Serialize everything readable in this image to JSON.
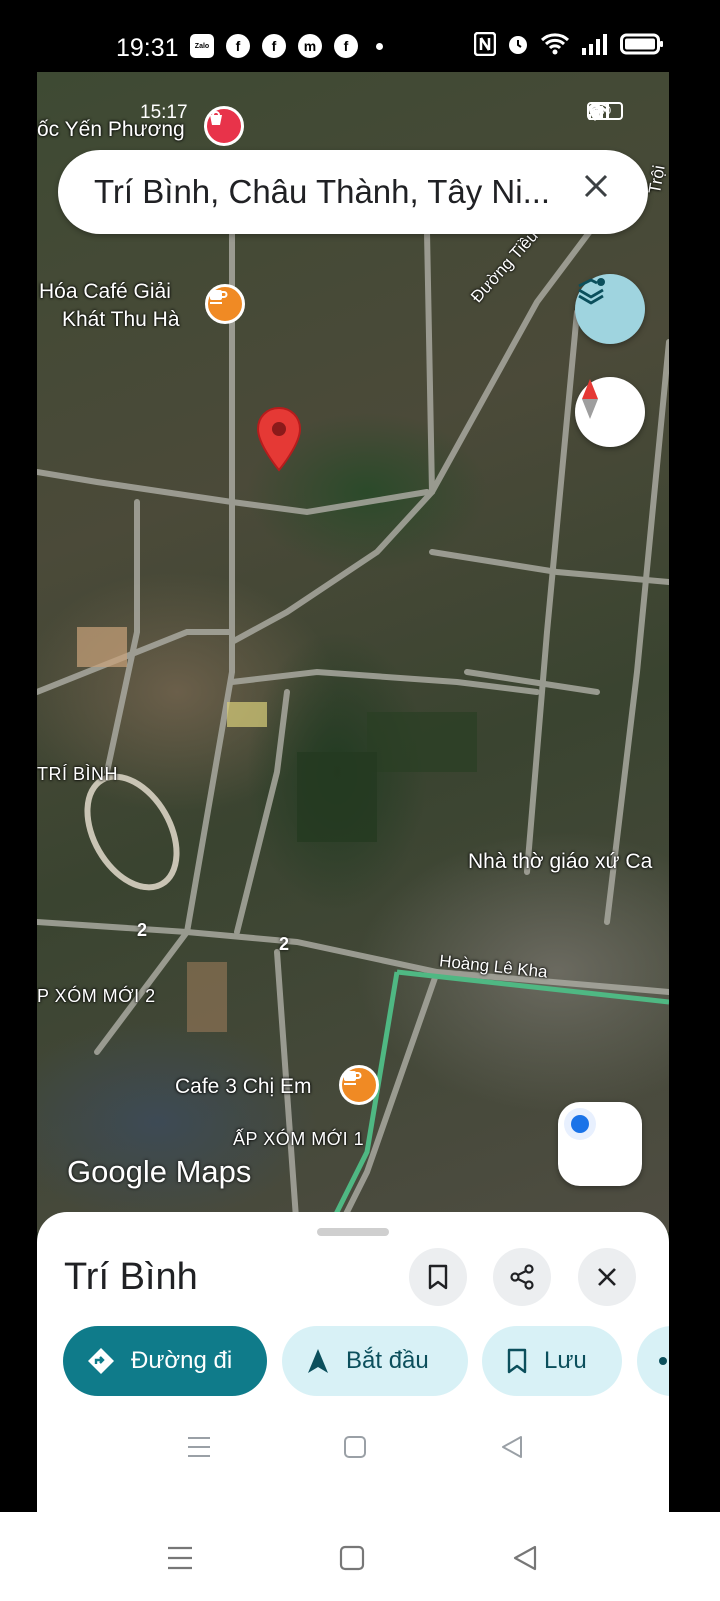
{
  "phone_status": {
    "time": "19:31",
    "apps": [
      "zalo-icon",
      "facebook-icon",
      "facebook-icon",
      "messenger-icon",
      "facebook-icon"
    ],
    "right_icons": [
      "nfc-icon",
      "alarm-icon",
      "wifi-icon",
      "signal-icon",
      "battery-icon"
    ]
  },
  "inner_status": {
    "time": "15:17",
    "battery": "90"
  },
  "search": {
    "query": "Trí Bình, Châu Thành, Tây Ni..."
  },
  "map": {
    "labels": {
      "yen_phuong": "ốc Yến Phương",
      "cafe_giai_khat_1": "Hóa Café Giải",
      "cafe_giai_khat_2": "Khát Thu Hà",
      "duong_tieu": "Đường Tiều",
      "troi": "Trội",
      "tri_binh": "TRÍ BÌNH",
      "nha_tho": "Nhà thờ giáo xứ Ca",
      "hoang_le_kha": "Hoàng Lê Kha",
      "xom_moi_2": "P XÓM MỚI 2",
      "cafe_3_chi_em": "Cafe 3 Chị Em",
      "xom_moi_1": "ẤP XÓM MỚI 1",
      "route_2a": "2",
      "route_2b": "2"
    },
    "watermark_google": "Google",
    "watermark_maps": "Maps"
  },
  "sheet": {
    "title": "Trí Bình",
    "chips": {
      "directions": "Đường đi",
      "start": "Bắt đầu",
      "save": "Lưu"
    }
  },
  "colors": {
    "primary_chip": "#0f7b8a",
    "secondary_chip": "#d8f1f6",
    "pin": "#e53935",
    "poi_cafe": "#f08a24",
    "location_dot": "#1a73e8"
  }
}
